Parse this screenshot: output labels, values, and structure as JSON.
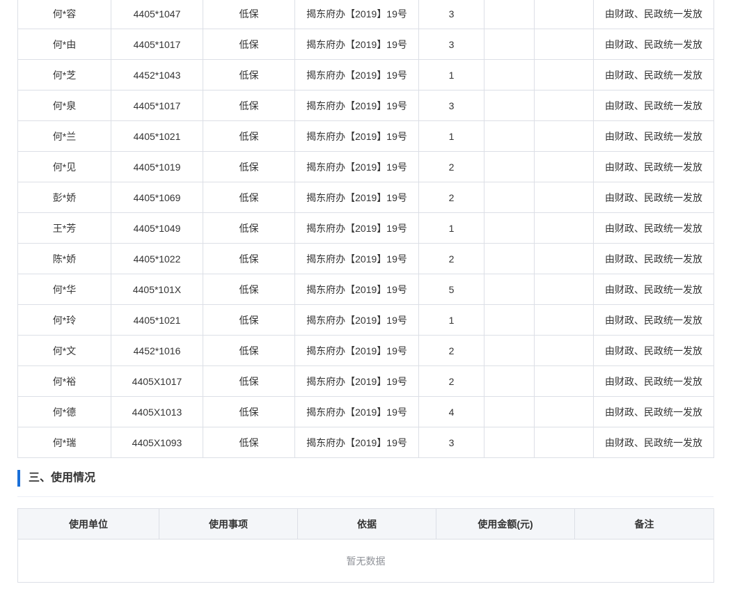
{
  "recipients": [
    {
      "name": "何*容",
      "id": "4405*1047",
      "type": "低保",
      "basis": "揭东府办【2019】19号",
      "count": "3",
      "col6": "",
      "col7": "",
      "note": "由财政、民政统一发放"
    },
    {
      "name": "何*由",
      "id": "4405*1017",
      "type": "低保",
      "basis": "揭东府办【2019】19号",
      "count": "3",
      "col6": "",
      "col7": "",
      "note": "由财政、民政统一发放"
    },
    {
      "name": "何*芝",
      "id": "4452*1043",
      "type": "低保",
      "basis": "揭东府办【2019】19号",
      "count": "1",
      "col6": "",
      "col7": "",
      "note": "由财政、民政统一发放"
    },
    {
      "name": "何*泉",
      "id": "4405*1017",
      "type": "低保",
      "basis": "揭东府办【2019】19号",
      "count": "3",
      "col6": "",
      "col7": "",
      "note": "由财政、民政统一发放"
    },
    {
      "name": "何*兰",
      "id": "4405*1021",
      "type": "低保",
      "basis": "揭东府办【2019】19号",
      "count": "1",
      "col6": "",
      "col7": "",
      "note": "由财政、民政统一发放"
    },
    {
      "name": "何*见",
      "id": "4405*1019",
      "type": "低保",
      "basis": "揭东府办【2019】19号",
      "count": "2",
      "col6": "",
      "col7": "",
      "note": "由财政、民政统一发放"
    },
    {
      "name": "彭*娇",
      "id": "4405*1069",
      "type": "低保",
      "basis": "揭东府办【2019】19号",
      "count": "2",
      "col6": "",
      "col7": "",
      "note": "由财政、民政统一发放"
    },
    {
      "name": "王*芳",
      "id": "4405*1049",
      "type": "低保",
      "basis": "揭东府办【2019】19号",
      "count": "1",
      "col6": "",
      "col7": "",
      "note": "由财政、民政统一发放"
    },
    {
      "name": "陈*娇",
      "id": "4405*1022",
      "type": "低保",
      "basis": "揭东府办【2019】19号",
      "count": "2",
      "col6": "",
      "col7": "",
      "note": "由财政、民政统一发放"
    },
    {
      "name": "何*华",
      "id": "4405*101X",
      "type": "低保",
      "basis": "揭东府办【2019】19号",
      "count": "5",
      "col6": "",
      "col7": "",
      "note": "由财政、民政统一发放"
    },
    {
      "name": "何*玲",
      "id": "4405*1021",
      "type": "低保",
      "basis": "揭东府办【2019】19号",
      "count": "1",
      "col6": "",
      "col7": "",
      "note": "由财政、民政统一发放"
    },
    {
      "name": "何*文",
      "id": "4452*1016",
      "type": "低保",
      "basis": "揭东府办【2019】19号",
      "count": "2",
      "col6": "",
      "col7": "",
      "note": "由财政、民政统一发放"
    },
    {
      "name": "何*裕",
      "id": "4405X1017",
      "type": "低保",
      "basis": "揭东府办【2019】19号",
      "count": "2",
      "col6": "",
      "col7": "",
      "note": "由财政、民政统一发放"
    },
    {
      "name": "何*德",
      "id": "4405X1013",
      "type": "低保",
      "basis": "揭东府办【2019】19号",
      "count": "4",
      "col6": "",
      "col7": "",
      "note": "由财政、民政统一发放"
    },
    {
      "name": "何*瑞",
      "id": "4405X1093",
      "type": "低保",
      "basis": "揭东府办【2019】19号",
      "count": "3",
      "col6": "",
      "col7": "",
      "note": "由财政、民政统一发放"
    }
  ],
  "usage_section": {
    "title": "三、使用情况",
    "headers": [
      "使用单位",
      "使用事项",
      "依据",
      "使用金额(元)",
      "备注"
    ],
    "empty_text": "暂无数据"
  },
  "colors": {
    "accent_bar": "#1a6fd8",
    "border": "#dcdfe6",
    "header_bg": "#f4f6f9",
    "empty_text": "#909399"
  }
}
